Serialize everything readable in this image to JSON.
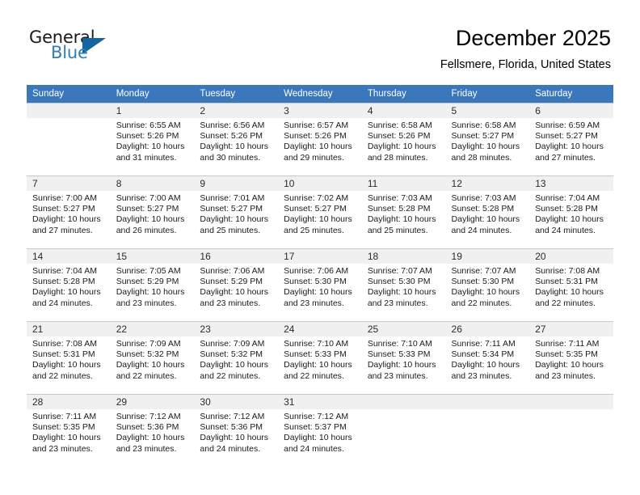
{
  "brand": {
    "word1": "General",
    "word2": "Blue",
    "logo_icon": "triangle-logo-icon",
    "accent_color": "#2e7ebb"
  },
  "header": {
    "title": "December 2025",
    "subtitle": "Fellsmere, Florida, United States"
  },
  "calendar": {
    "header_bg": "#3a78bb",
    "daynum_band_bg": "#f0f0f0",
    "weekday_headers": [
      "Sunday",
      "Monday",
      "Tuesday",
      "Wednesday",
      "Thursday",
      "Friday",
      "Saturday"
    ],
    "weeks": [
      [
        {
          "day": "",
          "sunrise": "",
          "sunset": "",
          "daylight_line1": "",
          "daylight_line2": ""
        },
        {
          "day": "1",
          "sunrise": "Sunrise: 6:55 AM",
          "sunset": "Sunset: 5:26 PM",
          "daylight_line1": "Daylight: 10 hours",
          "daylight_line2": "and 31 minutes."
        },
        {
          "day": "2",
          "sunrise": "Sunrise: 6:56 AM",
          "sunset": "Sunset: 5:26 PM",
          "daylight_line1": "Daylight: 10 hours",
          "daylight_line2": "and 30 minutes."
        },
        {
          "day": "3",
          "sunrise": "Sunrise: 6:57 AM",
          "sunset": "Sunset: 5:26 PM",
          "daylight_line1": "Daylight: 10 hours",
          "daylight_line2": "and 29 minutes."
        },
        {
          "day": "4",
          "sunrise": "Sunrise: 6:58 AM",
          "sunset": "Sunset: 5:26 PM",
          "daylight_line1": "Daylight: 10 hours",
          "daylight_line2": "and 28 minutes."
        },
        {
          "day": "5",
          "sunrise": "Sunrise: 6:58 AM",
          "sunset": "Sunset: 5:27 PM",
          "daylight_line1": "Daylight: 10 hours",
          "daylight_line2": "and 28 minutes."
        },
        {
          "day": "6",
          "sunrise": "Sunrise: 6:59 AM",
          "sunset": "Sunset: 5:27 PM",
          "daylight_line1": "Daylight: 10 hours",
          "daylight_line2": "and 27 minutes."
        }
      ],
      [
        {
          "day": "7",
          "sunrise": "Sunrise: 7:00 AM",
          "sunset": "Sunset: 5:27 PM",
          "daylight_line1": "Daylight: 10 hours",
          "daylight_line2": "and 27 minutes."
        },
        {
          "day": "8",
          "sunrise": "Sunrise: 7:00 AM",
          "sunset": "Sunset: 5:27 PM",
          "daylight_line1": "Daylight: 10 hours",
          "daylight_line2": "and 26 minutes."
        },
        {
          "day": "9",
          "sunrise": "Sunrise: 7:01 AM",
          "sunset": "Sunset: 5:27 PM",
          "daylight_line1": "Daylight: 10 hours",
          "daylight_line2": "and 25 minutes."
        },
        {
          "day": "10",
          "sunrise": "Sunrise: 7:02 AM",
          "sunset": "Sunset: 5:27 PM",
          "daylight_line1": "Daylight: 10 hours",
          "daylight_line2": "and 25 minutes."
        },
        {
          "day": "11",
          "sunrise": "Sunrise: 7:03 AM",
          "sunset": "Sunset: 5:28 PM",
          "daylight_line1": "Daylight: 10 hours",
          "daylight_line2": "and 25 minutes."
        },
        {
          "day": "12",
          "sunrise": "Sunrise: 7:03 AM",
          "sunset": "Sunset: 5:28 PM",
          "daylight_line1": "Daylight: 10 hours",
          "daylight_line2": "and 24 minutes."
        },
        {
          "day": "13",
          "sunrise": "Sunrise: 7:04 AM",
          "sunset": "Sunset: 5:28 PM",
          "daylight_line1": "Daylight: 10 hours",
          "daylight_line2": "and 24 minutes."
        }
      ],
      [
        {
          "day": "14",
          "sunrise": "Sunrise: 7:04 AM",
          "sunset": "Sunset: 5:28 PM",
          "daylight_line1": "Daylight: 10 hours",
          "daylight_line2": "and 24 minutes."
        },
        {
          "day": "15",
          "sunrise": "Sunrise: 7:05 AM",
          "sunset": "Sunset: 5:29 PM",
          "daylight_line1": "Daylight: 10 hours",
          "daylight_line2": "and 23 minutes."
        },
        {
          "day": "16",
          "sunrise": "Sunrise: 7:06 AM",
          "sunset": "Sunset: 5:29 PM",
          "daylight_line1": "Daylight: 10 hours",
          "daylight_line2": "and 23 minutes."
        },
        {
          "day": "17",
          "sunrise": "Sunrise: 7:06 AM",
          "sunset": "Sunset: 5:30 PM",
          "daylight_line1": "Daylight: 10 hours",
          "daylight_line2": "and 23 minutes."
        },
        {
          "day": "18",
          "sunrise": "Sunrise: 7:07 AM",
          "sunset": "Sunset: 5:30 PM",
          "daylight_line1": "Daylight: 10 hours",
          "daylight_line2": "and 23 minutes."
        },
        {
          "day": "19",
          "sunrise": "Sunrise: 7:07 AM",
          "sunset": "Sunset: 5:30 PM",
          "daylight_line1": "Daylight: 10 hours",
          "daylight_line2": "and 22 minutes."
        },
        {
          "day": "20",
          "sunrise": "Sunrise: 7:08 AM",
          "sunset": "Sunset: 5:31 PM",
          "daylight_line1": "Daylight: 10 hours",
          "daylight_line2": "and 22 minutes."
        }
      ],
      [
        {
          "day": "21",
          "sunrise": "Sunrise: 7:08 AM",
          "sunset": "Sunset: 5:31 PM",
          "daylight_line1": "Daylight: 10 hours",
          "daylight_line2": "and 22 minutes."
        },
        {
          "day": "22",
          "sunrise": "Sunrise: 7:09 AM",
          "sunset": "Sunset: 5:32 PM",
          "daylight_line1": "Daylight: 10 hours",
          "daylight_line2": "and 22 minutes."
        },
        {
          "day": "23",
          "sunrise": "Sunrise: 7:09 AM",
          "sunset": "Sunset: 5:32 PM",
          "daylight_line1": "Daylight: 10 hours",
          "daylight_line2": "and 22 minutes."
        },
        {
          "day": "24",
          "sunrise": "Sunrise: 7:10 AM",
          "sunset": "Sunset: 5:33 PM",
          "daylight_line1": "Daylight: 10 hours",
          "daylight_line2": "and 22 minutes."
        },
        {
          "day": "25",
          "sunrise": "Sunrise: 7:10 AM",
          "sunset": "Sunset: 5:33 PM",
          "daylight_line1": "Daylight: 10 hours",
          "daylight_line2": "and 23 minutes."
        },
        {
          "day": "26",
          "sunrise": "Sunrise: 7:11 AM",
          "sunset": "Sunset: 5:34 PM",
          "daylight_line1": "Daylight: 10 hours",
          "daylight_line2": "and 23 minutes."
        },
        {
          "day": "27",
          "sunrise": "Sunrise: 7:11 AM",
          "sunset": "Sunset: 5:35 PM",
          "daylight_line1": "Daylight: 10 hours",
          "daylight_line2": "and 23 minutes."
        }
      ],
      [
        {
          "day": "28",
          "sunrise": "Sunrise: 7:11 AM",
          "sunset": "Sunset: 5:35 PM",
          "daylight_line1": "Daylight: 10 hours",
          "daylight_line2": "and 23 minutes."
        },
        {
          "day": "29",
          "sunrise": "Sunrise: 7:12 AM",
          "sunset": "Sunset: 5:36 PM",
          "daylight_line1": "Daylight: 10 hours",
          "daylight_line2": "and 23 minutes."
        },
        {
          "day": "30",
          "sunrise": "Sunrise: 7:12 AM",
          "sunset": "Sunset: 5:36 PM",
          "daylight_line1": "Daylight: 10 hours",
          "daylight_line2": "and 24 minutes."
        },
        {
          "day": "31",
          "sunrise": "Sunrise: 7:12 AM",
          "sunset": "Sunset: 5:37 PM",
          "daylight_line1": "Daylight: 10 hours",
          "daylight_line2": "and 24 minutes."
        },
        {
          "day": "",
          "sunrise": "",
          "sunset": "",
          "daylight_line1": "",
          "daylight_line2": ""
        },
        {
          "day": "",
          "sunrise": "",
          "sunset": "",
          "daylight_line1": "",
          "daylight_line2": ""
        },
        {
          "day": "",
          "sunrise": "",
          "sunset": "",
          "daylight_line1": "",
          "daylight_line2": ""
        }
      ]
    ]
  }
}
